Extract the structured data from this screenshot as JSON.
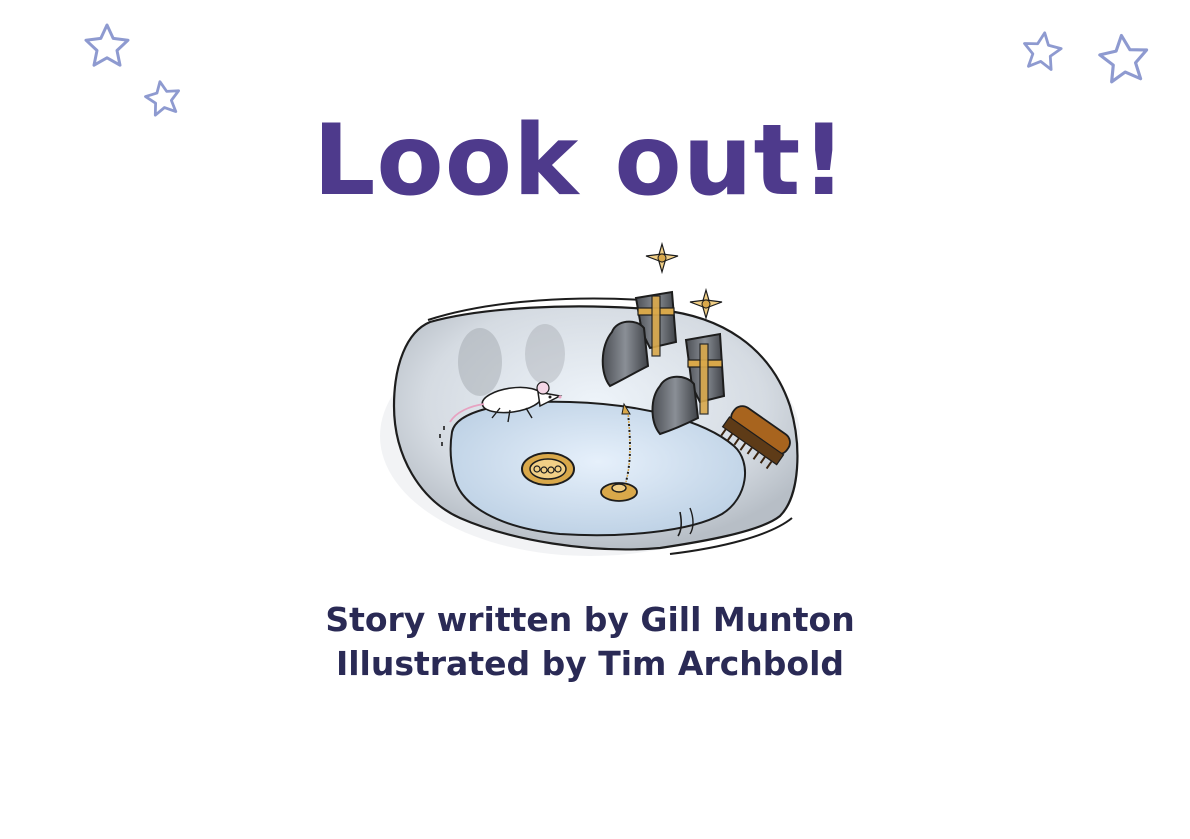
{
  "cover": {
    "title": "Look out!",
    "author_line": "Story written by Gill Munton",
    "illustrator_line": "Illustrated by Tim Archbold"
  },
  "illustration": {
    "subject": "sink-with-mouse-taps-and-scrubbing-brush"
  },
  "colors": {
    "title": "#4e3a8c",
    "credits": "#2a2a55",
    "star_outline": "#8e9ad0"
  }
}
